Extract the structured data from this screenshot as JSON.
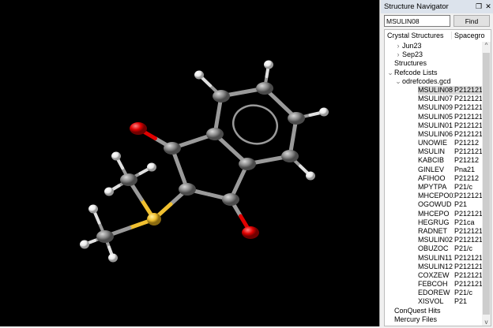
{
  "panel": {
    "title": "Structure Navigator",
    "search_value": "MSULIN08",
    "find_label": "Find",
    "col_structures": "Crystal Structures",
    "col_spacegroup": "Spacegro"
  },
  "tree": {
    "jun": "Jun23",
    "sep": "Sep23",
    "structures": "Structures",
    "refcode_lists": "Refcode Lists",
    "gcd": "odrefcodes.gcd",
    "conquest": "ConQuest Hits",
    "mercury": "Mercury Files"
  },
  "entries": [
    {
      "name": "MSULIN08",
      "sg": "P212121",
      "selected": true
    },
    {
      "name": "MSULIN07",
      "sg": "P212121"
    },
    {
      "name": "MSULIN09",
      "sg": "P212121"
    },
    {
      "name": "MSULIN05",
      "sg": "P212121"
    },
    {
      "name": "MSULIN01",
      "sg": "P212121"
    },
    {
      "name": "MSULIN06",
      "sg": "P212121"
    },
    {
      "name": "UNOWIE",
      "sg": "P21212"
    },
    {
      "name": "MSULIN",
      "sg": "P212121"
    },
    {
      "name": "KABCIB",
      "sg": "P21212"
    },
    {
      "name": "GINLEV",
      "sg": "Pna21"
    },
    {
      "name": "AFIHOO",
      "sg": "P21212"
    },
    {
      "name": "MPYTPA",
      "sg": "P21/c"
    },
    {
      "name": "MHCEPO01",
      "sg": "P212121"
    },
    {
      "name": "OGOWUD",
      "sg": "P21"
    },
    {
      "name": "MHCEPO",
      "sg": "P212121"
    },
    {
      "name": "HEGRUG",
      "sg": "P21ca"
    },
    {
      "name": "RADNET",
      "sg": "P212121"
    },
    {
      "name": "MSULIN02",
      "sg": "P212121"
    },
    {
      "name": "OBUZOC",
      "sg": "P21/c"
    },
    {
      "name": "MSULIN11",
      "sg": "P212121"
    },
    {
      "name": "MSULIN12",
      "sg": "P212121"
    },
    {
      "name": "COXZEW",
      "sg": "P212121"
    },
    {
      "name": "FEBCOH",
      "sg": "P212121"
    },
    {
      "name": "EDOREW",
      "sg": "P21/c"
    },
    {
      "name": "XISVOL",
      "sg": "P21"
    }
  ],
  "colors": {
    "carbon": "#8c8c8c",
    "oxygen": "#e00000",
    "sulfur": "#f0c030",
    "hydrogen": "#ffffff",
    "background": "#000000"
  }
}
